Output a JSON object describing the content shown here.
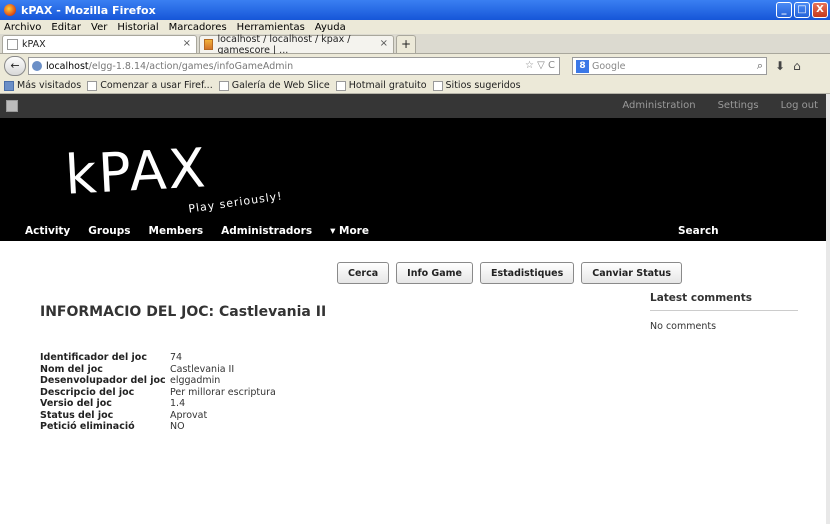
{
  "window": {
    "title": "kPAX - Mozilla Firefox",
    "controls": [
      "_",
      "□",
      "X"
    ]
  },
  "menu": [
    "Archivo",
    "Editar",
    "Ver",
    "Historial",
    "Marcadores",
    "Herramientas",
    "Ayuda"
  ],
  "tabs": [
    {
      "label": "kPAX",
      "close": "×"
    },
    {
      "label": "localhost / localhost / kpax / gamescore | ...",
      "close": "×"
    }
  ],
  "newtab": "+",
  "nav": {
    "back": "←",
    "url_host": "localhost",
    "url_path": "/elgg-1.8.14/action/games/infoGameAdmin",
    "url_tools": "☆ ▽ C",
    "search_engine": "8",
    "search_placeholder": "Google",
    "search_icon": "⌕",
    "download_icon": "⬇",
    "home_icon": "⌂"
  },
  "bookmarks": [
    "Más visitados",
    "Comenzar a usar Firef...",
    "Galería de Web Slice",
    "Hotmail gratuito",
    "Sitios sugeridos"
  ],
  "site": {
    "toplinks": [
      "Administration",
      "Settings",
      "Log out"
    ],
    "logo": "kPAX",
    "tagline": "Play seriously!",
    "nav": [
      "Activity",
      "Groups",
      "Members",
      "Administradors",
      "▾ More"
    ],
    "search": "Search"
  },
  "actions": [
    "Cerca",
    "Info Game",
    "Estadistiques",
    "Canviar Status"
  ],
  "game": {
    "title": "INFORMACIO DEL JOC: Castlevania II",
    "fields": [
      {
        "label": "Identificador del joc",
        "value": "74"
      },
      {
        "label": "Nom del joc",
        "value": "Castlevania II"
      },
      {
        "label": "Desenvolupador del joc",
        "value": "elggadmin"
      },
      {
        "label": "Descripcio del joc",
        "value": "Per millorar escriptura"
      },
      {
        "label": "Versio del joc",
        "value": "1.4"
      },
      {
        "label": "Status del joc",
        "value": "Aprovat"
      },
      {
        "label": "Petició eliminació",
        "value": "NO"
      }
    ]
  },
  "sidebar": {
    "heading": "Latest comments",
    "empty": "No comments"
  }
}
